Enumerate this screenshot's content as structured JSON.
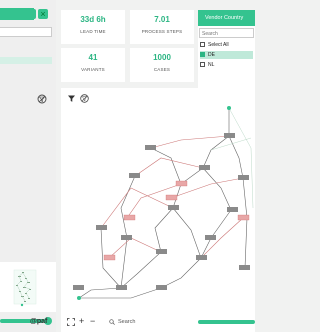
{
  "left": {
    "close_glyph": "×"
  },
  "kpis": [
    {
      "value": "33d 6h",
      "label": "LEAD TIME"
    },
    {
      "value": "7.01",
      "label": "PROCESS STEPS"
    },
    {
      "value": "41",
      "label": "VARIANTS"
    },
    {
      "value": "1000",
      "label": "CASES"
    }
  ],
  "vendor_filter": {
    "title": "Vendor Country",
    "search_placeholder": "Search",
    "items": [
      {
        "label": "Select All",
        "checked": false
      },
      {
        "label": "DE",
        "checked": true
      },
      {
        "label": "NL",
        "checked": false
      }
    ]
  },
  "footer": {
    "logo_text": "@paf",
    "search_placeholder": "Search",
    "zoom_in": "+",
    "zoom_out": "−"
  },
  "colors": {
    "accent": "#34c38f",
    "kpi_value": "#2bb583",
    "highlight_node": "#e8a7a7"
  },
  "icons": {
    "left_filter": "filter-slash-icon",
    "filter": "funnel-icon",
    "filter_off": "filter-slash-icon",
    "fit": "fit-screen-icon",
    "search": "search-icon"
  }
}
